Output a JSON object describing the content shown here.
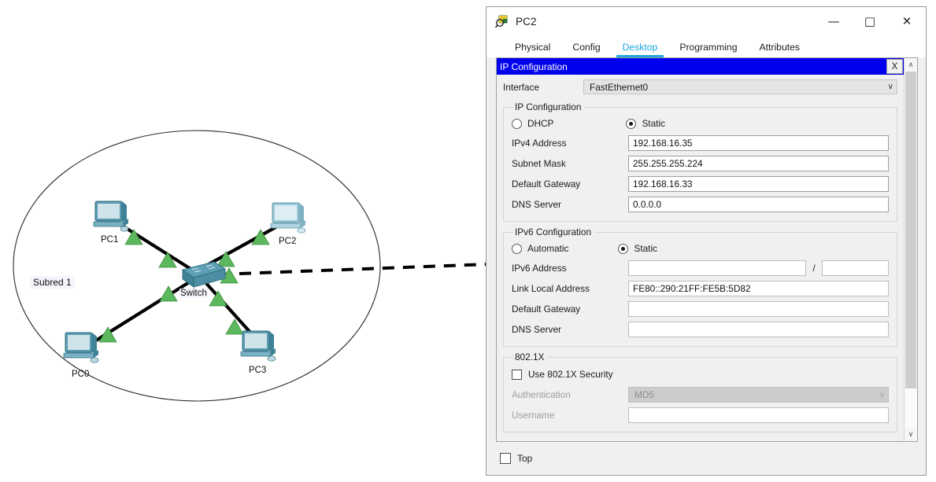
{
  "topology": {
    "subnet_label": "Subred 1",
    "nodes": [
      {
        "id": "pc1",
        "label": "PC1",
        "type": "pc"
      },
      {
        "id": "pc2",
        "label": "PC2",
        "type": "pc"
      },
      {
        "id": "pc0",
        "label": "PC0",
        "type": "pc"
      },
      {
        "id": "pc3",
        "label": "PC3",
        "type": "pc"
      },
      {
        "id": "switch",
        "label": "Switch",
        "type": "switch"
      }
    ]
  },
  "window": {
    "title": "PC2",
    "icon": "packet-tracer-device-icon",
    "minimize_label": "—",
    "maximize_label": "□",
    "close_label": "✕"
  },
  "tabs": [
    {
      "label": "Physical",
      "active": false
    },
    {
      "label": "Config",
      "active": false
    },
    {
      "label": "Desktop",
      "active": true
    },
    {
      "label": "Programming",
      "active": false
    },
    {
      "label": "Attributes",
      "active": false
    }
  ],
  "ip_configuration": {
    "window_title": "IP Configuration",
    "close_label": "X",
    "interface": {
      "label": "Interface",
      "value": "FastEthernet0",
      "chevron": "∨"
    },
    "ipv4": {
      "legend": "IP Configuration",
      "dhcp_label": "DHCP",
      "dhcp_selected": false,
      "static_label": "Static",
      "static_selected": true,
      "fields": [
        {
          "label": "IPv4 Address",
          "value": "192.168.16.35"
        },
        {
          "label": "Subnet Mask",
          "value": "255.255.255.224"
        },
        {
          "label": "Default Gateway",
          "value": "192.168.16.33"
        },
        {
          "label": "DNS Server",
          "value": "0.0.0.0"
        }
      ]
    },
    "ipv6": {
      "legend": "IPv6 Configuration",
      "automatic_label": "Automatic",
      "automatic_selected": false,
      "static_label": "Static",
      "static_selected": true,
      "address_label": "IPv6 Address",
      "address_value": "",
      "prefix_separator": "/",
      "prefix_value": "",
      "fields": [
        {
          "label": "Link Local Address",
          "value": "FE80::290:21FF:FE5B:5D82"
        },
        {
          "label": "Default Gateway",
          "value": ""
        },
        {
          "label": "DNS Server",
          "value": ""
        }
      ]
    },
    "dot1x": {
      "legend": "802.1X",
      "use_security_label": "Use 802.1X Security",
      "use_security_checked": false,
      "authentication_label": "Authentication",
      "authentication_value": "MD5",
      "authentication_chevron": "∨",
      "username_label": "Username",
      "username_value": ""
    }
  },
  "footer": {
    "top_label": "Top",
    "top_checked": false
  },
  "scrollbar": {
    "up_arrow": "∧",
    "down_arrow": "∨"
  },
  "colors": {
    "titlebar_blue": "#0000ee",
    "tab_accent": "#1ca5dc",
    "window_bg": "#f0f0f0",
    "link_green": "#5cb85c"
  }
}
